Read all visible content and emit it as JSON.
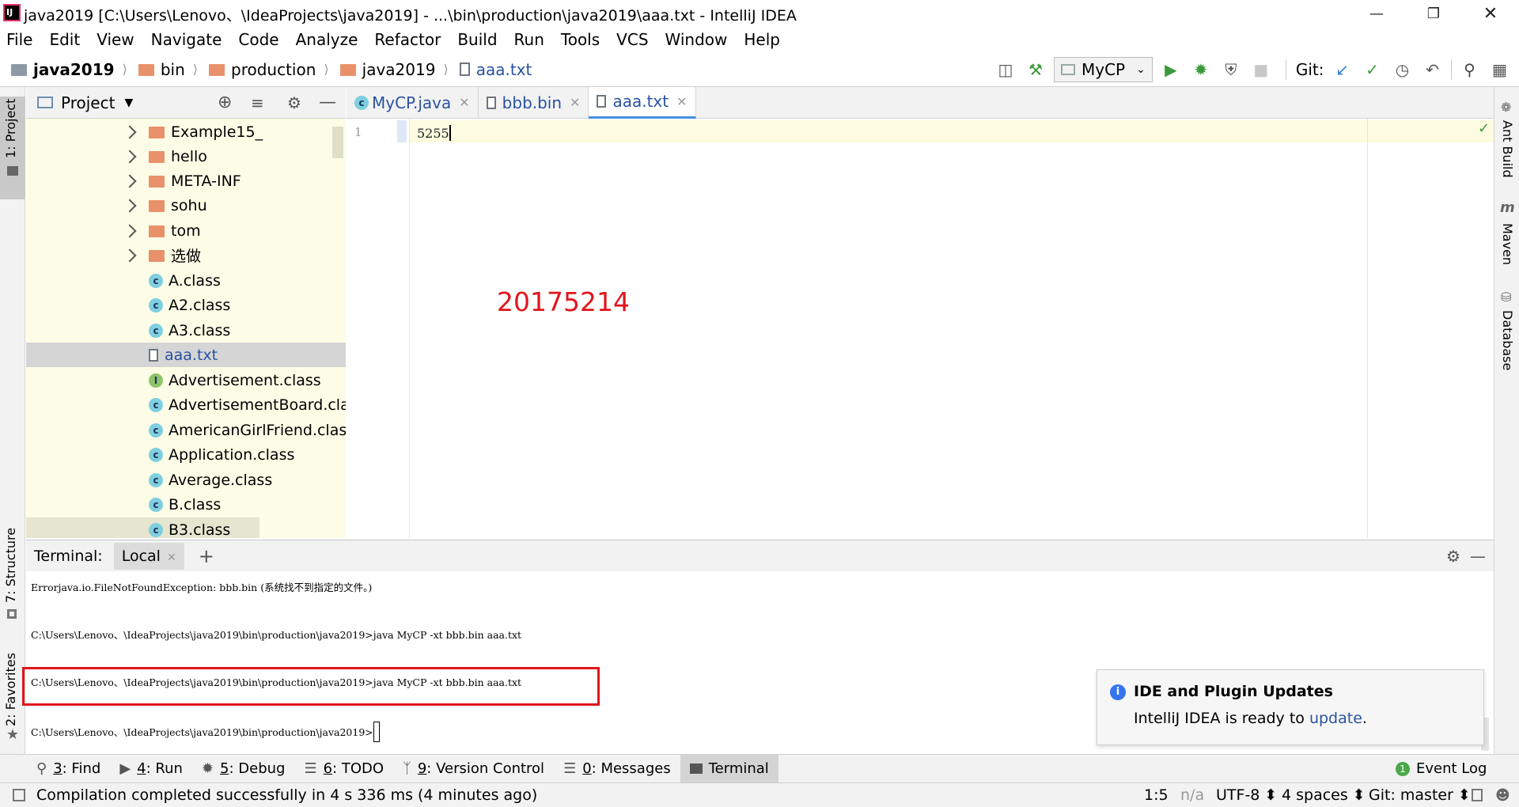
{
  "window": {
    "title": "java2019 [C:\\Users\\Lenovo、\\IdeaProjects\\java2019] - ...\\bin\\production\\java2019\\aaa.txt - IntelliJ IDEA",
    "logo_text": "IJ"
  },
  "menu": [
    "File",
    "Edit",
    "View",
    "Navigate",
    "Code",
    "Analyze",
    "Refactor",
    "Build",
    "Run",
    "Tools",
    "VCS",
    "Window",
    "Help"
  ],
  "breadcrumb": [
    "java2019",
    "bin",
    "production",
    "java2019",
    "aaa.txt"
  ],
  "toolbar": {
    "run_config": "MyCP",
    "git_label": "Git:"
  },
  "left_stripe": {
    "project": "1: Project",
    "structure": "7: Structure",
    "favorites": "2: Favorites"
  },
  "right_stripe": {
    "ant": "Ant Build",
    "maven": "Maven",
    "database": "Database"
  },
  "project_panel": {
    "title": "Project",
    "folders": [
      "Example15_",
      "hello",
      "META-INF",
      "sohu",
      "tom",
      "选做"
    ],
    "files": [
      {
        "name": "A.class",
        "kind": "class"
      },
      {
        "name": "A2.class",
        "kind": "class"
      },
      {
        "name": "A3.class",
        "kind": "class"
      },
      {
        "name": "aaa.txt",
        "kind": "text",
        "selected": true
      },
      {
        "name": "Advertisement.class",
        "kind": "interface"
      },
      {
        "name": "AdvertisementBoard.class",
        "kind": "class"
      },
      {
        "name": "AmericanGirlFriend.class",
        "kind": "class"
      },
      {
        "name": "Application.class",
        "kind": "class"
      },
      {
        "name": "Average.class",
        "kind": "class"
      },
      {
        "name": "B.class",
        "kind": "class"
      },
      {
        "name": "B3.class",
        "kind": "class"
      }
    ]
  },
  "editor": {
    "tabs": [
      {
        "label": "MyCP.java",
        "kind": "java"
      },
      {
        "label": "bbb.bin",
        "kind": "bin"
      },
      {
        "label": "aaa.txt",
        "kind": "text",
        "active": true
      }
    ],
    "line_number": "1",
    "content": "5255",
    "overlay_text": "20175214",
    "overlay_color": "#e0161d"
  },
  "terminal": {
    "header_label": "Terminal:",
    "session_tab": "Local",
    "lines": [
      "Errorjava.io.FileNotFoundException: bbb.bin (系统找不到指定的文件。)",
      "C:\\Users\\Lenovo、\\IdeaProjects\\java2019\\bin\\production\\java2019>java MyCP -xt bbb.bin aaa.txt",
      "C:\\Users\\Lenovo、\\IdeaProjects\\java2019\\bin\\production\\java2019>java MyCP -xt bbb.bin aaa.txt",
      "C:\\Users\\Lenovo、\\IdeaProjects\\java2019\\bin\\production\\java2019>"
    ]
  },
  "notification": {
    "title": "IDE and Plugin Updates",
    "body": "IntelliJ IDEA is ready to",
    "link": "update",
    "suffix": "."
  },
  "bottom_tabs": [
    {
      "num": "3",
      "label": ": Find",
      "icon": "search-icon"
    },
    {
      "num": "4",
      "label": ": Run",
      "icon": "play-icon"
    },
    {
      "num": "5",
      "label": ": Debug",
      "icon": "bug-icon"
    },
    {
      "num": "6",
      "label": ": TODO",
      "icon": "list-icon"
    },
    {
      "num": "9",
      "label": ": Version Control",
      "icon": "branch-icon"
    },
    {
      "num": "0",
      "label": ": Messages",
      "icon": "messages-icon"
    },
    {
      "num": "",
      "label": "Terminal",
      "icon": "terminal-icon",
      "active": true
    }
  ],
  "event_log": {
    "count": "1",
    "label": "Event Log"
  },
  "status": {
    "message": "Compilation completed successfully in 4 s 336 ms (4 minutes ago)",
    "position": "1:5",
    "na": "n/a",
    "encoding": "UTF-8 ⬍",
    "indent": "4 spaces ⬍",
    "git": "Git: master ⬍"
  },
  "colors": {
    "accent": "#2a52a0",
    "run_green": "#3a9a3a",
    "folder": "#e8916a",
    "tree_bg": "#fdfce6"
  }
}
